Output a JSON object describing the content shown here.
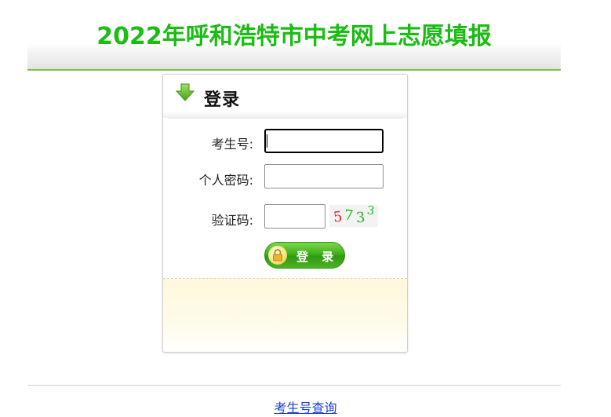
{
  "page": {
    "title": "2022年呼和浩特市中考网上志愿填报"
  },
  "login": {
    "heading": "登录",
    "fields": [
      {
        "label": "考生号:",
        "value": "",
        "placeholder": ""
      },
      {
        "label": "个人密码:",
        "value": "",
        "placeholder": ""
      },
      {
        "label": "验证码:",
        "value": "",
        "placeholder": ""
      }
    ],
    "captcha": {
      "digits": [
        "5",
        "7",
        "3",
        "3"
      ],
      "colors": [
        "#d9262f",
        "#22b81a",
        "#2bb52c",
        "#2cb22a"
      ]
    },
    "submit_label": "登 录"
  },
  "footer": {
    "link_label": "考生号查询"
  },
  "colors": {
    "title_green": "#1bbc13",
    "header_rule": "#7dc242",
    "button_green": "#3fae1a",
    "link_blue": "#1a3ecc",
    "footer_panel": "#fff8dc"
  },
  "icons": {
    "heading_icon": "green-down-arrow-icon",
    "button_icon": "padlock-icon"
  }
}
